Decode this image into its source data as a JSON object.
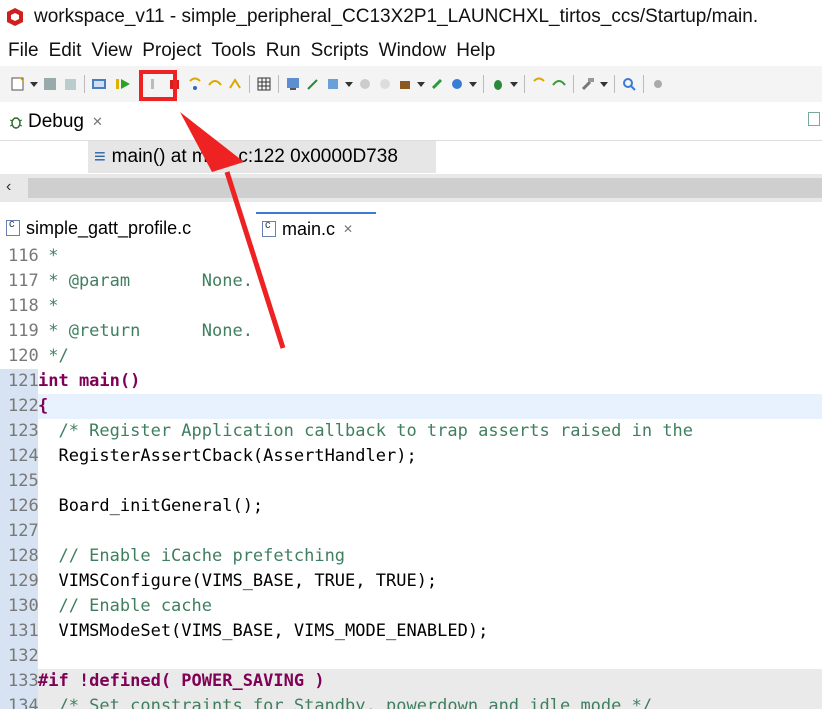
{
  "window": {
    "title": "workspace_v11 - simple_peripheral_CC13X2P1_LAUNCHXL_tirtos_ccs/Startup/main."
  },
  "menu": [
    "File",
    "Edit",
    "View",
    "Project",
    "Tools",
    "Run",
    "Scripts",
    "Window",
    "Help"
  ],
  "debug_view": {
    "label": "Debug",
    "close": "✕",
    "frame_text": "main() at main.c:122 0x0000D738"
  },
  "scroll": {
    "left_arrow": "‹"
  },
  "editor_tabs": [
    {
      "label": "simple_gatt_profile.c",
      "active": false
    },
    {
      "label": "main.c",
      "active": true,
      "close": "✕"
    }
  ],
  "colors": {
    "highlight": "#ee2222",
    "accent": "#3a7bd5"
  },
  "code": [
    {
      "n": "116",
      "t": " *"
    },
    {
      "n": "117",
      "t": " * @param       None."
    },
    {
      "n": "118",
      "t": " *"
    },
    {
      "n": "119",
      "t": " * @return      None."
    },
    {
      "n": "120",
      "t": " */"
    },
    {
      "n": "121",
      "t": "int main()"
    },
    {
      "n": "122",
      "t": "{"
    },
    {
      "n": "123",
      "t": "  /* Register Application callback to trap asserts raised in the"
    },
    {
      "n": "124",
      "t": "  RegisterAssertCback(AssertHandler);"
    },
    {
      "n": "125",
      "t": ""
    },
    {
      "n": "126",
      "t": "  Board_initGeneral();"
    },
    {
      "n": "127",
      "t": ""
    },
    {
      "n": "128",
      "t": "  // Enable iCache prefetching"
    },
    {
      "n": "129",
      "t": "  VIMSConfigure(VIMS_BASE, TRUE, TRUE);"
    },
    {
      "n": "130",
      "t": "  // Enable cache"
    },
    {
      "n": "131",
      "t": "  VIMSModeSet(VIMS_BASE, VIMS_MODE_ENABLED);"
    },
    {
      "n": "132",
      "t": ""
    },
    {
      "n": "133",
      "t": "#if !defined( POWER_SAVING )"
    },
    {
      "n": "134",
      "t": "  /* Set constraints for Standby, powerdown and idle mode */"
    }
  ]
}
